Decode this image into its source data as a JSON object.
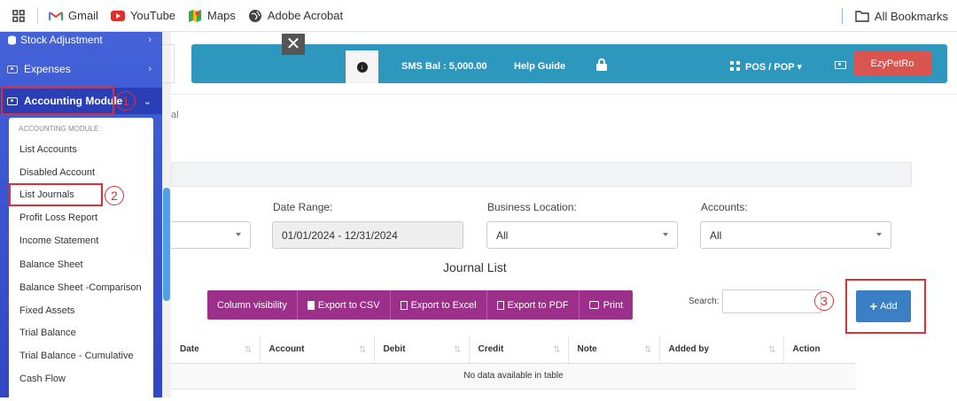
{
  "bookmarks": {
    "items": [
      {
        "label": "Gmail"
      },
      {
        "label": "YouTube"
      },
      {
        "label": "Maps"
      },
      {
        "label": "Adobe Acrobat"
      }
    ],
    "all_bookmarks": "All Bookmarks"
  },
  "sidebar": {
    "items": [
      {
        "label": "Stock Adjustment",
        "icon": "database-icon"
      },
      {
        "label": "Expenses",
        "icon": "money-icon"
      },
      {
        "label": "Accounting Module",
        "icon": "money-icon"
      }
    ],
    "submenu": {
      "heading": "ACCOUNTING MODULE :",
      "items": [
        "List Accounts",
        "Disabled Account",
        "List Journals",
        "Profit Loss Report",
        "Income Statement",
        "Balance Sheet",
        "Balance Sheet -Comparison",
        "Fixed Assets",
        "Trial Balance",
        "Trial Balance - Cumulative",
        "Cash Flow"
      ]
    }
  },
  "annotations": {
    "badge1": "1",
    "badge2": "2",
    "badge3": "3"
  },
  "topbar": {
    "close": "✕",
    "sms_balance": "SMS Bal : 5,000.00",
    "help_guide": "Help Guide",
    "pos_pop": "POS / POP ▾",
    "user_button": "EzyPetRo"
  },
  "page": {
    "breadcrumb_fragment": "al",
    "title": "Journal List"
  },
  "filters": {
    "date_range": {
      "label": "Date Range:",
      "value": "01/01/2024 - 12/31/2024"
    },
    "business_location": {
      "label": "Business Location:",
      "value": "All"
    },
    "accounts": {
      "label": "Accounts:",
      "value": "All"
    }
  },
  "export_buttons": [
    "Column visibility",
    "Export to CSV",
    "Export to Excel",
    "Export to PDF",
    "Print"
  ],
  "search": {
    "label": "Search:",
    "placeholder": ""
  },
  "add_button": {
    "label": "Add"
  },
  "table": {
    "columns": [
      "Date",
      "Account",
      "Debit",
      "Credit",
      "Note",
      "Added by",
      "Action"
    ],
    "empty_message": "No data available in table"
  },
  "colors": {
    "topbar": "#2e97bd",
    "sidebar": "#3b55d0",
    "export": "#9c2f8a",
    "add": "#3a7fc4",
    "user_button": "#d9534f",
    "highlight": "#d9313a"
  }
}
